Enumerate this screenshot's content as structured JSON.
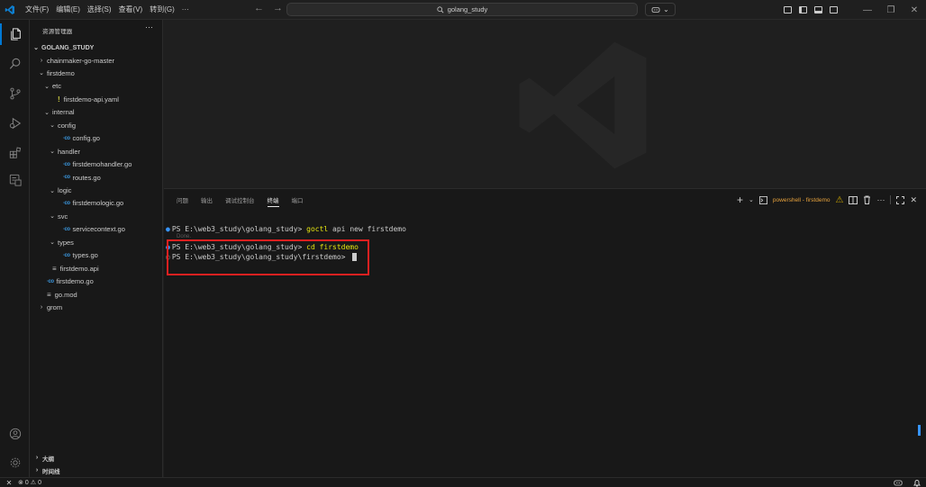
{
  "titlebar": {
    "menus": [
      "文件(F)",
      "编辑(E)",
      "选择(S)",
      "查看(V)",
      "转到(G)",
      "···"
    ],
    "search_text": "golang_study",
    "copilot_chevron": "⌄",
    "window_controls": {
      "minimize": "—",
      "restore": "❐",
      "close": "✕"
    }
  },
  "sidebar": {
    "header": "资源管理器",
    "more": "···",
    "root": "GOLANG_STUDY",
    "tree": [
      {
        "label": "chainmaker-go-master",
        "depth": 1,
        "twistie": "›",
        "icon": ""
      },
      {
        "label": "firstdemo",
        "depth": 1,
        "twistie": "⌄",
        "icon": ""
      },
      {
        "label": "etc",
        "depth": 2,
        "twistie": "⌄",
        "icon": ""
      },
      {
        "label": "firstdemo-api.yaml",
        "depth": 3,
        "twistie": "",
        "icon": "yaml"
      },
      {
        "label": "internal",
        "depth": 2,
        "twistie": "⌄",
        "icon": ""
      },
      {
        "label": "config",
        "depth": 3,
        "twistie": "⌄",
        "icon": ""
      },
      {
        "label": "config.go",
        "depth": 4,
        "twistie": "",
        "icon": "go"
      },
      {
        "label": "handler",
        "depth": 3,
        "twistie": "⌄",
        "icon": ""
      },
      {
        "label": "firstdemohandler.go",
        "depth": 4,
        "twistie": "",
        "icon": "go"
      },
      {
        "label": "routes.go",
        "depth": 4,
        "twistie": "",
        "icon": "go"
      },
      {
        "label": "logic",
        "depth": 3,
        "twistie": "⌄",
        "icon": ""
      },
      {
        "label": "firstdemologic.go",
        "depth": 4,
        "twistie": "",
        "icon": "go"
      },
      {
        "label": "svc",
        "depth": 3,
        "twistie": "⌄",
        "icon": ""
      },
      {
        "label": "servicecontext.go",
        "depth": 4,
        "twistie": "",
        "icon": "go"
      },
      {
        "label": "types",
        "depth": 3,
        "twistie": "⌄",
        "icon": ""
      },
      {
        "label": "types.go",
        "depth": 4,
        "twistie": "",
        "icon": "go"
      },
      {
        "label": "firstdemo.api",
        "depth": 2,
        "twistie": "",
        "icon": "eq"
      },
      {
        "label": "firstdemo.go",
        "depth": 1,
        "twistie": "",
        "icon": "go"
      },
      {
        "label": "go.mod",
        "depth": 1,
        "twistie": "",
        "icon": "eq"
      },
      {
        "label": "grom",
        "depth": 1,
        "twistie": "›",
        "icon": ""
      }
    ],
    "go_glyph": "·co",
    "yaml_glyph": "!",
    "eq_glyph": "≡",
    "outline": "大纲",
    "timeline": "时间线",
    "section_twistie": "›"
  },
  "panel": {
    "tabs": [
      "问题",
      "输出",
      "调试控制台",
      "终端",
      "端口"
    ],
    "active_tab": "终端",
    "terminal_name": "powershell - firstdemo",
    "add_icon": "+",
    "add_chevron": "⌄",
    "more": "···"
  },
  "terminal": {
    "line1_prompt": "PS E:\\web3_study\\golang_study> ",
    "line1_cmd": "goctl",
    "line1_rest": " api new firstdemo",
    "done": "Done.",
    "line2_prompt": "PS E:\\web3_study\\golang_study> ",
    "line2_cmd": "cd firstdemo",
    "line3_prompt": "PS E:\\web3_study\\golang_study\\firstdemo> "
  },
  "statusbar": {
    "errors": "0",
    "warnings": "0",
    "remote_glyph": "✕"
  },
  "colors": {
    "accent": "#0078d4",
    "highlight_box": "#e02020",
    "command_yellow": "#e5e510",
    "go_icon": "#3a96dd",
    "terminal_tab_name": "#e8a33d"
  }
}
